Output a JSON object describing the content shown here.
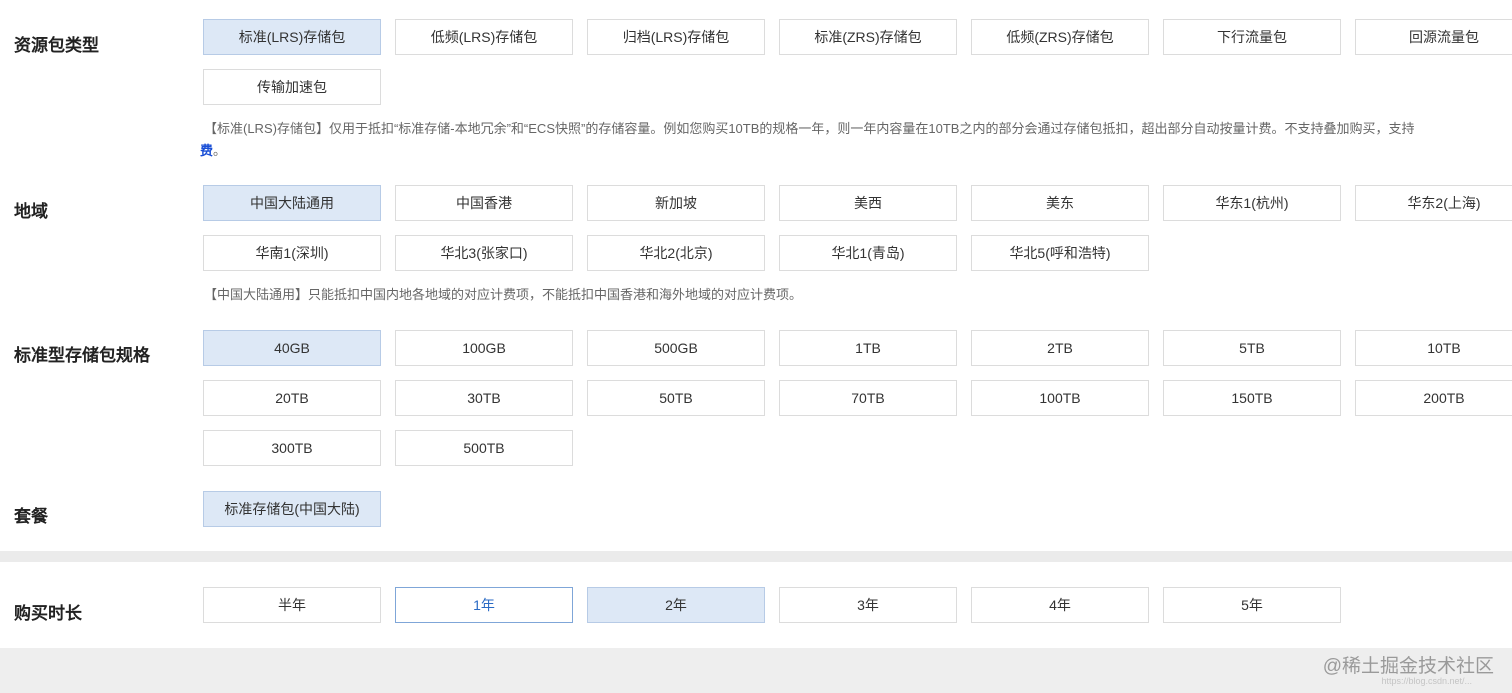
{
  "resource_type": {
    "label": "资源包类型",
    "options": [
      "标准(LRS)存储包",
      "低频(LRS)存储包",
      "归档(LRS)存储包",
      "标准(ZRS)存储包",
      "低频(ZRS)存储包",
      "下行流量包",
      "回源流量包",
      "传输加速包"
    ],
    "selected": "标准(LRS)存储包",
    "note_line1": "【标准(LRS)存储包】仅用于抵扣“标准存储-本地冗余”和“ECS快照”的存储容量。例如您购买10TB的规格一年，则一年内容量在10TB之内的部分会通过存储包抵扣，超出部分自动按量计费。不支持叠加购买，支持",
    "note_link": "费",
    "note_line2_suffix": "。"
  },
  "region": {
    "label": "地域",
    "options": [
      "中国大陆通用",
      "中国香港",
      "新加坡",
      "美西",
      "美东",
      "华东1(杭州)",
      "华东2(上海)",
      "华南1(深圳)",
      "华北3(张家口)",
      "华北2(北京)",
      "华北1(青岛)",
      "华北5(呼和浩特)"
    ],
    "selected": "中国大陆通用",
    "note": "【中国大陆通用】只能抵扣中国内地各地域的对应计费项，不能抵扣中国香港和海外地域的对应计费项。"
  },
  "spec": {
    "label": "标准型存储包规格",
    "options": [
      "40GB",
      "100GB",
      "500GB",
      "1TB",
      "2TB",
      "5TB",
      "10TB",
      "20TB",
      "30TB",
      "50TB",
      "70TB",
      "100TB",
      "150TB",
      "200TB",
      "300TB",
      "500TB"
    ],
    "selected": "40GB"
  },
  "package": {
    "label": "套餐",
    "options": [
      "标准存储包(中国大陆)"
    ],
    "selected": "标准存储包(中国大陆)"
  },
  "duration": {
    "label": "购买时长",
    "options": [
      "半年",
      "1年",
      "2年",
      "3年",
      "4年",
      "5年"
    ],
    "selected": "2年",
    "hovered": "1年"
  },
  "watermark": {
    "text": "@稀土掘金技术社区",
    "sub": "https://blog.csdn.net/..."
  },
  "colors": {
    "selected_bg": "#dde8f6",
    "link": "#1a4fd6",
    "hover_text": "#2a6ac4"
  }
}
